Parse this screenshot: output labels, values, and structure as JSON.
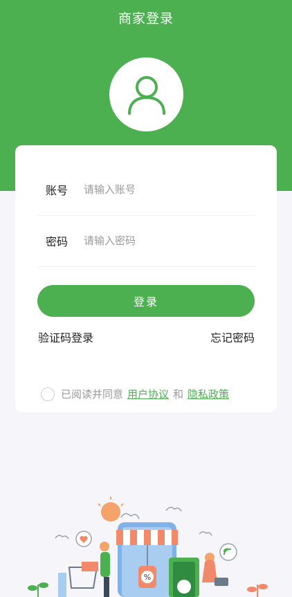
{
  "header": {
    "title": "商家登录",
    "background": "#4caf50"
  },
  "avatar": {
    "icon": "user-icon"
  },
  "form": {
    "account": {
      "label": "账号",
      "placeholder": "请输入账号",
      "value": ""
    },
    "password": {
      "label": "密码",
      "placeholder": "请输入密码",
      "value": ""
    },
    "login_label": "登录"
  },
  "links": {
    "sms_login": "验证码登录",
    "forgot_password": "忘记密码"
  },
  "agreement": {
    "checked": false,
    "prefix": "已阅读并同意",
    "user_agreement": "用户协议",
    "conjunction": "和",
    "privacy_policy": "隐私政策"
  },
  "colors": {
    "accent": "#4caf50",
    "page_background": "#f5f5fa"
  }
}
